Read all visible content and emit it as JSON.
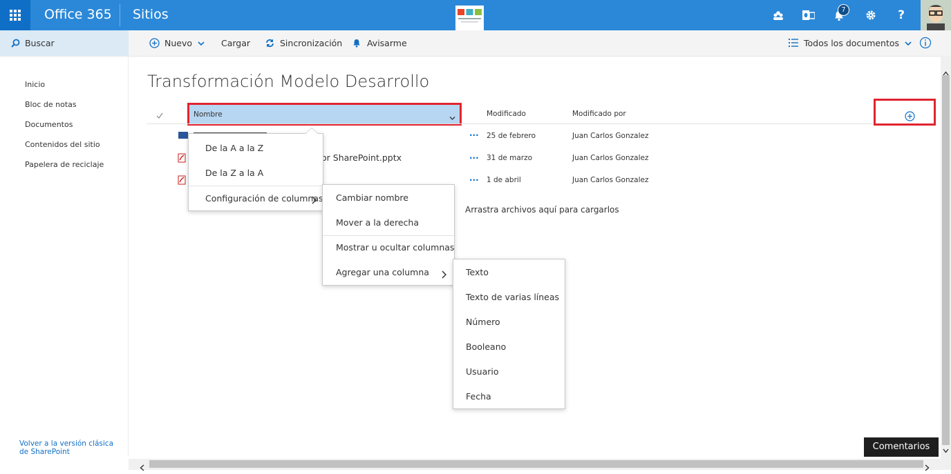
{
  "suite": {
    "brand": "Office 365",
    "site": "Sitios",
    "notification_count": "7",
    "help": "?"
  },
  "commands": {
    "search": "Buscar",
    "new": "Nuevo",
    "upload": "Cargar",
    "sync": "Sincronización",
    "alert": "Avisarme",
    "view": "Todos los documentos"
  },
  "nav": {
    "items": [
      "Inicio",
      "Bloc de notas",
      "Documentos",
      "Contenidos del sitio",
      "Papelera de reciclaje"
    ],
    "classic_link": "Volver a la versión clásica de SharePoint"
  },
  "library": {
    "title": "Transformación Modelo Desarrollo",
    "columns": {
      "name": "Nombre",
      "modified": "Modificado",
      "modified_by": "Modificado por"
    },
    "rows": [
      {
        "name_fragment": "",
        "modified": "25 de febrero",
        "modified_by": "Juan Carlos Gonzalez"
      },
      {
        "name_fragment": "or SharePoint.pptx",
        "modified": "31 de marzo",
        "modified_by": "Juan Carlos Gonzalez"
      },
      {
        "name_fragment": "",
        "modified": "1 de abril",
        "modified_by": "Juan Carlos Gonzalez"
      }
    ],
    "drop_hint": "Arrastra archivos aquí para cargarlos"
  },
  "sort_menu": {
    "asc": "De la A a la Z",
    "desc": "De la Z a la A",
    "column_settings": "Configuración de columnas"
  },
  "column_menu": {
    "rename": "Cambiar nombre",
    "move_right": "Mover a la derecha",
    "show_hide": "Mostrar u ocultar columnas",
    "add_column": "Agregar una columna"
  },
  "type_menu": {
    "items": [
      "Texto",
      "Texto de varias líneas",
      "Número",
      "Booleano",
      "Usuario",
      "Fecha"
    ]
  },
  "feedback": "Comentarios",
  "colors": {
    "suite_bar": "#2b88d8",
    "waffle": "#0f6fc6",
    "accent": "#0f6fc6",
    "highlight_border": "#e0242e",
    "header_selected": "#b7d6f2"
  }
}
